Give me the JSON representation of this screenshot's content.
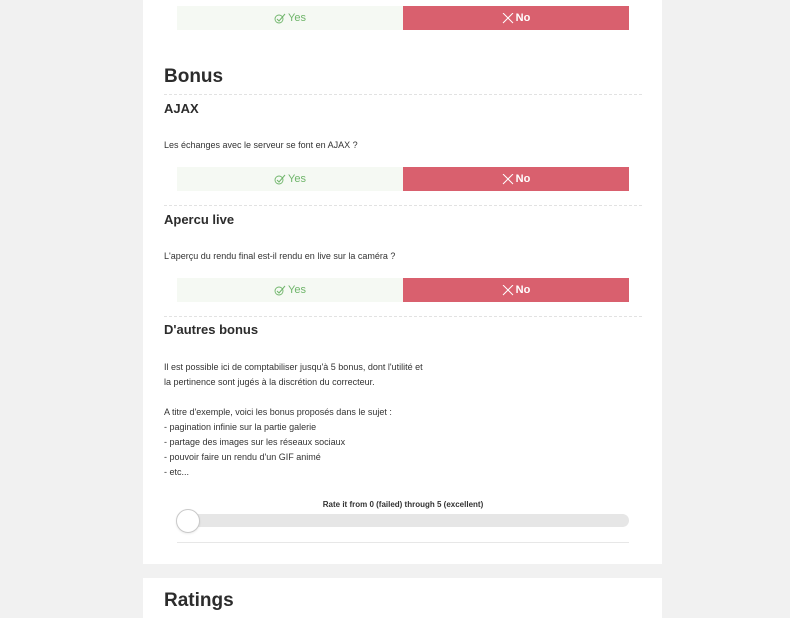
{
  "answers": {
    "yes_label": "Yes",
    "no_label": "No"
  },
  "bonus_section": {
    "title": "Bonus",
    "items": [
      {
        "title": "AJAX",
        "question": "Les échanges avec le serveur se font en AJAX ?"
      },
      {
        "title": "Apercu live",
        "question": "L'aperçu du rendu final est-il rendu en live sur la caméra ?"
      }
    ],
    "other": {
      "title": "D'autres bonus",
      "lines": [
        "Il est possible ici de comptabiliser jusqu'à 5 bonus, dont l'utilité et",
        "la pertinence sont jugés à la discrétion du correcteur.",
        "",
        "A titre d'exemple, voici les bonus proposés dans le sujet :",
        "- pagination infinie sur la partie galerie",
        "- partage des images sur les réseaux sociaux",
        "- pouvoir faire un rendu d'un GIF animé",
        "- etc..."
      ],
      "rate_label": "Rate it from 0 (failed) through 5 (excellent)",
      "rate_value": 0,
      "rate_max": 5
    }
  },
  "ratings_section": {
    "title": "Ratings"
  },
  "colors": {
    "yes_bg": "#f5f9f3",
    "yes_text": "#6fb56a",
    "no_bg": "#d9606e",
    "page_bg": "#f1f1f1"
  }
}
